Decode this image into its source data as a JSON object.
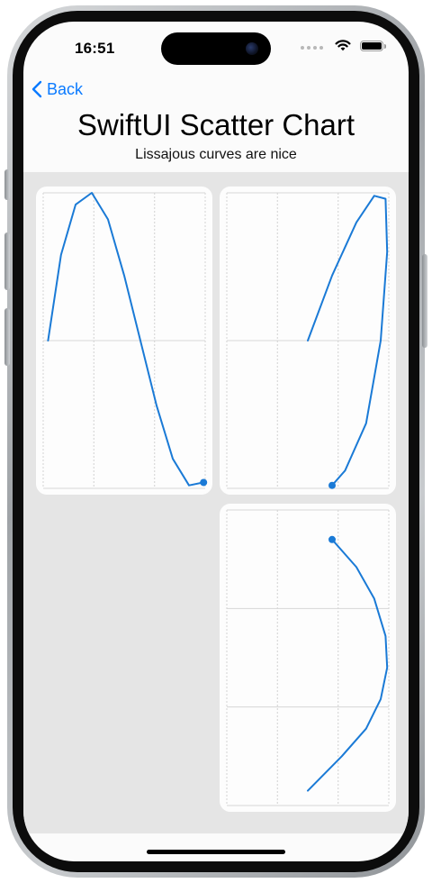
{
  "status_bar": {
    "time": "16:51",
    "icons": [
      "cellular-signal-icon",
      "wifi-icon",
      "battery-icon"
    ]
  },
  "nav": {
    "back_label": "Back",
    "back_icon": "chevron-left-icon"
  },
  "header": {
    "title": "SwiftUI Scatter Chart",
    "subtitle": "Lissajous curves are nice"
  },
  "colors": {
    "accent": "#0a7aff",
    "curve": "#1a7ad6",
    "background": "#e5e5e5",
    "card": "#fdfdfd"
  },
  "chart_data": [
    {
      "type": "line",
      "title": "",
      "xlabel": "",
      "ylabel": "",
      "xlim": [
        -1,
        1
      ],
      "ylim": [
        -1,
        1
      ],
      "grid": true,
      "series": [
        {
          "x": [
            -0.94,
            -0.78,
            -0.6,
            -0.4,
            -0.2,
            0.0,
            0.2,
            0.4,
            0.6,
            0.8,
            0.98
          ],
          "y": [
            0.0,
            0.58,
            0.92,
            1.0,
            0.82,
            0.44,
            0.0,
            -0.44,
            -0.8,
            -0.98,
            -0.96
          ]
        }
      ]
    },
    {
      "type": "line",
      "title": "",
      "xlabel": "",
      "ylabel": "",
      "xlim": [
        -1,
        1
      ],
      "ylim": [
        -1,
        1
      ],
      "grid": true,
      "series": [
        {
          "x": [
            0.0,
            0.3,
            0.6,
            0.82,
            0.96,
            0.98,
            0.9,
            0.72,
            0.46,
            0.3
          ],
          "y": [
            0.0,
            0.44,
            0.8,
            0.98,
            0.96,
            0.6,
            0.0,
            -0.56,
            -0.88,
            -0.98
          ]
        }
      ]
    },
    {
      "type": "line",
      "title": "",
      "xlabel": "",
      "ylabel": "",
      "xlim": [
        -1,
        1
      ],
      "ylim": [
        -1.5,
        1.5
      ],
      "grid": true,
      "series": [
        {
          "x": [
            0.3,
            0.6,
            0.82,
            0.96,
            0.98,
            0.9,
            0.72,
            0.42,
            0.0
          ],
          "y": [
            1.2,
            0.92,
            0.6,
            0.22,
            -0.1,
            -0.42,
            -0.72,
            -1.0,
            -1.35
          ]
        }
      ]
    }
  ]
}
